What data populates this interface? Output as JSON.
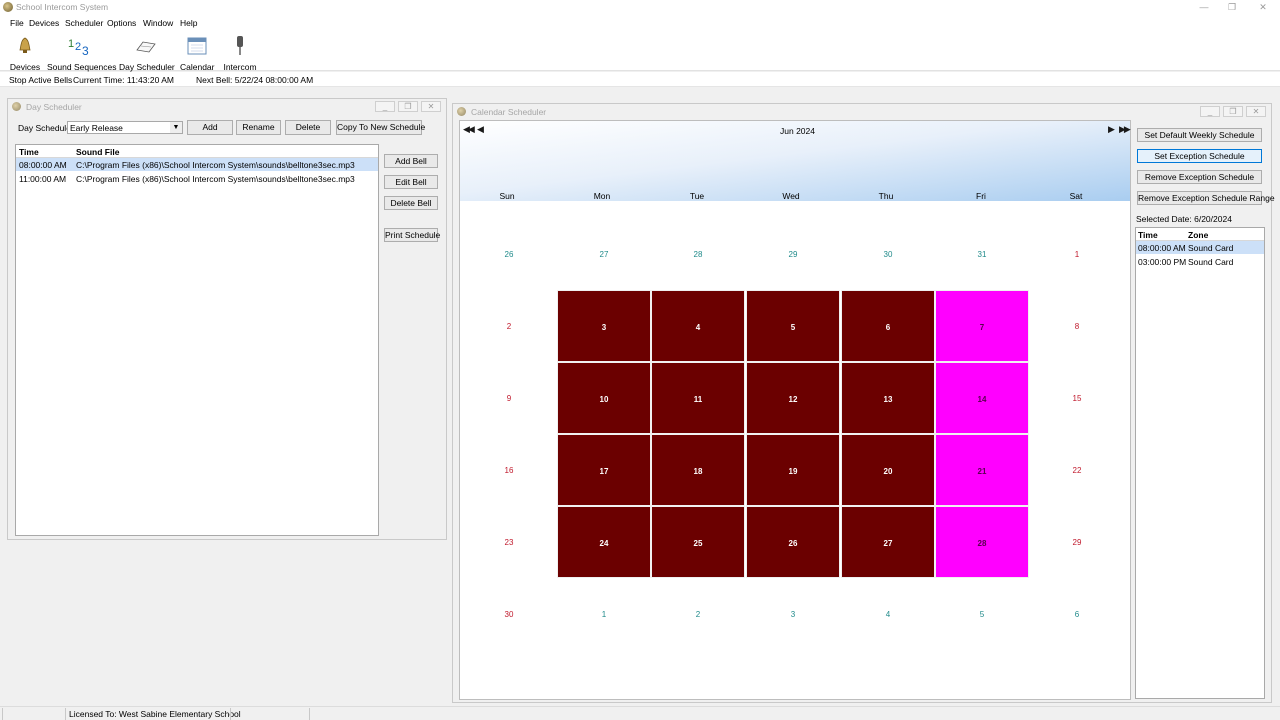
{
  "window": {
    "title": "School Intercom System",
    "controls": {
      "minimize": "—",
      "maximize": "❐",
      "close": "✕"
    }
  },
  "menu": [
    "File",
    "Devices",
    "Scheduler",
    "Options",
    "Window",
    "Help"
  ],
  "toolbar": {
    "devices": "Devices",
    "sound_sequences": "Sound Sequences",
    "day_scheduler": "Day Scheduler",
    "calendar": "Calendar",
    "intercom": "Intercom"
  },
  "status": {
    "stop_bells": "Stop Active Bells",
    "current_time": "Current Time: 11:43:20 AM",
    "next_bell": "Next Bell: 5/22/24 08:00:00 AM"
  },
  "day_scheduler": {
    "title": "Day Scheduler",
    "schedule_label": "Day Schedule:",
    "schedule_value": "Early Release",
    "add": "Add",
    "rename": "Rename",
    "delete": "Delete",
    "copy": "Copy To New Schedule",
    "columns": [
      "Time",
      "Sound File"
    ],
    "rows": [
      {
        "time": "08:00:00 AM",
        "file": "C:\\Program Files (x86)\\School Intercom System\\sounds\\belltone3sec.mp3"
      },
      {
        "time": "11:00:00 AM",
        "file": "C:\\Program Files (x86)\\School Intercom System\\sounds\\belltone3sec.mp3"
      }
    ],
    "add_bell": "Add Bell",
    "edit_bell": "Edit Bell",
    "delete_bell": "Delete Bell",
    "print": "Print Schedule"
  },
  "calendar": {
    "title": "Calendar Scheduler",
    "month": "Jun 2024",
    "days": [
      "Sun",
      "Mon",
      "Tue",
      "Wed",
      "Thu",
      "Fri",
      "Sat"
    ],
    "weeks": [
      [
        "26",
        "27",
        "28",
        "29",
        "30",
        "31",
        "1"
      ],
      [
        "2",
        "3",
        "4",
        "5",
        "6",
        "7",
        "8"
      ],
      [
        "9",
        "10",
        "11",
        "12",
        "13",
        "14",
        "15"
      ],
      [
        "16",
        "17",
        "18",
        "19",
        "20",
        "21",
        "22"
      ],
      [
        "23",
        "24",
        "25",
        "26",
        "27",
        "28",
        "29"
      ],
      [
        "30",
        "1",
        "2",
        "3",
        "4",
        "5",
        "6"
      ]
    ],
    "set_default": "Set Default Weekly Schedule",
    "set_exception": "Set Exception Schedule",
    "remove_exception": "Remove Exception Schedule",
    "remove_range": "Remove Exception Schedule Range",
    "selected_date": "Selected Date: 6/20/2024",
    "zone_columns": [
      "Time",
      "Zone"
    ],
    "zones": [
      {
        "time": "08:00:00 AM",
        "zone": "Sound Card"
      },
      {
        "time": "03:00:00 PM",
        "zone": "Sound Card"
      }
    ],
    "colors": {
      "scheduled": "#6b0000",
      "exception": "#ff00ff"
    }
  },
  "footer": {
    "license": "Licensed To: West Sabine Elementary School"
  }
}
